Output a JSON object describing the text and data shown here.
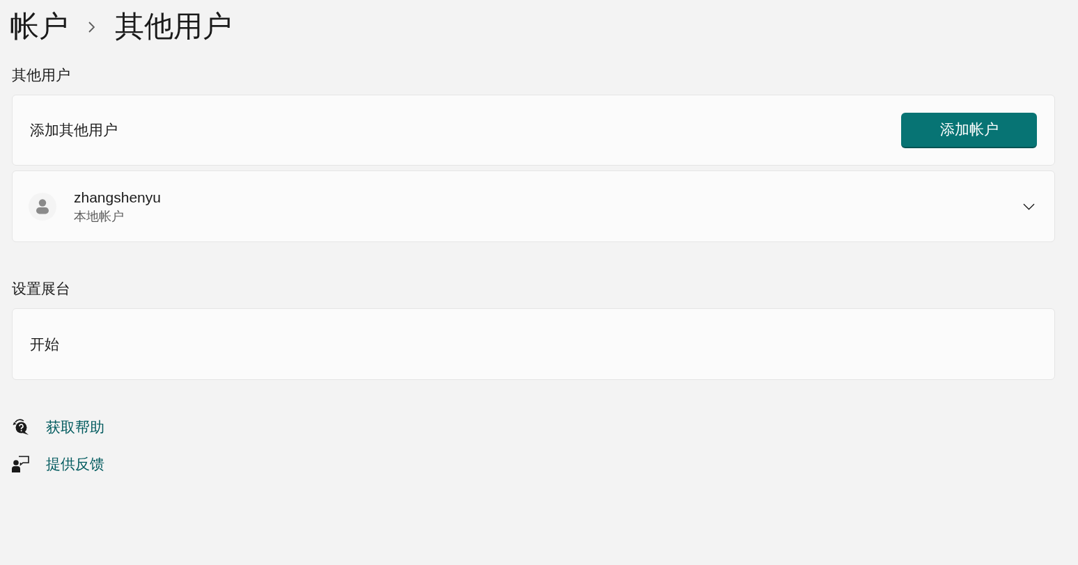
{
  "breadcrumb": [
    "帐户",
    "其他用户"
  ],
  "sections": [
    {
      "title": "其他用户",
      "cards": [
        {
          "kind": "action",
          "label": "添加其他用户",
          "button": "添加帐户"
        },
        {
          "kind": "account",
          "name": "zhangshenyu",
          "subtitle": "本地帐户",
          "expanded": false
        }
      ]
    },
    {
      "title": "设置展台",
      "cards": [
        {
          "kind": "plain",
          "label": "开始"
        }
      ]
    }
  ],
  "links": [
    {
      "kind": "help",
      "label": "获取帮助"
    },
    {
      "kind": "feedback",
      "label": "提供反馈"
    }
  ]
}
